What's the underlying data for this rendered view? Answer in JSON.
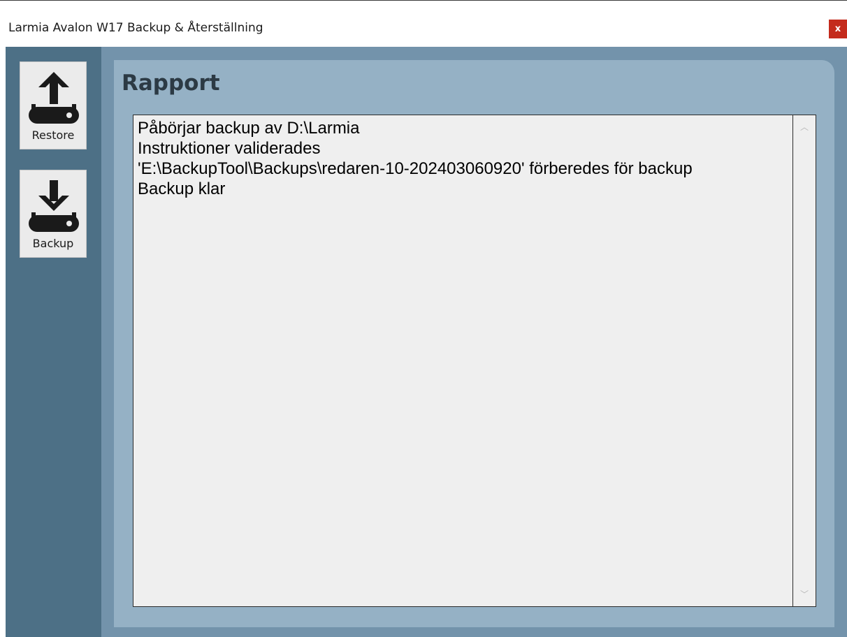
{
  "window": {
    "title": "Larmia Avalon W17 Backup & Återställning",
    "close_label": "x"
  },
  "sidebar": {
    "items": [
      {
        "label": "Restore",
        "icon": "upload-drive-icon"
      },
      {
        "label": "Backup",
        "icon": "download-drive-icon"
      }
    ]
  },
  "panel": {
    "title": "Rapport",
    "report_lines": [
      "Påbörjar backup av D:\\Larmia",
      "Instruktioner validerades",
      "'E:\\BackupTool\\Backups\\redaren-10-202403060920' förberedes för backup",
      "Backup klar"
    ]
  },
  "colors": {
    "sidebar_bg": "#4d7086",
    "body_bg": "#7393ab",
    "panel_bg": "#95b1c5",
    "report_bg": "#efefef",
    "close_bg": "#c42b1c"
  }
}
